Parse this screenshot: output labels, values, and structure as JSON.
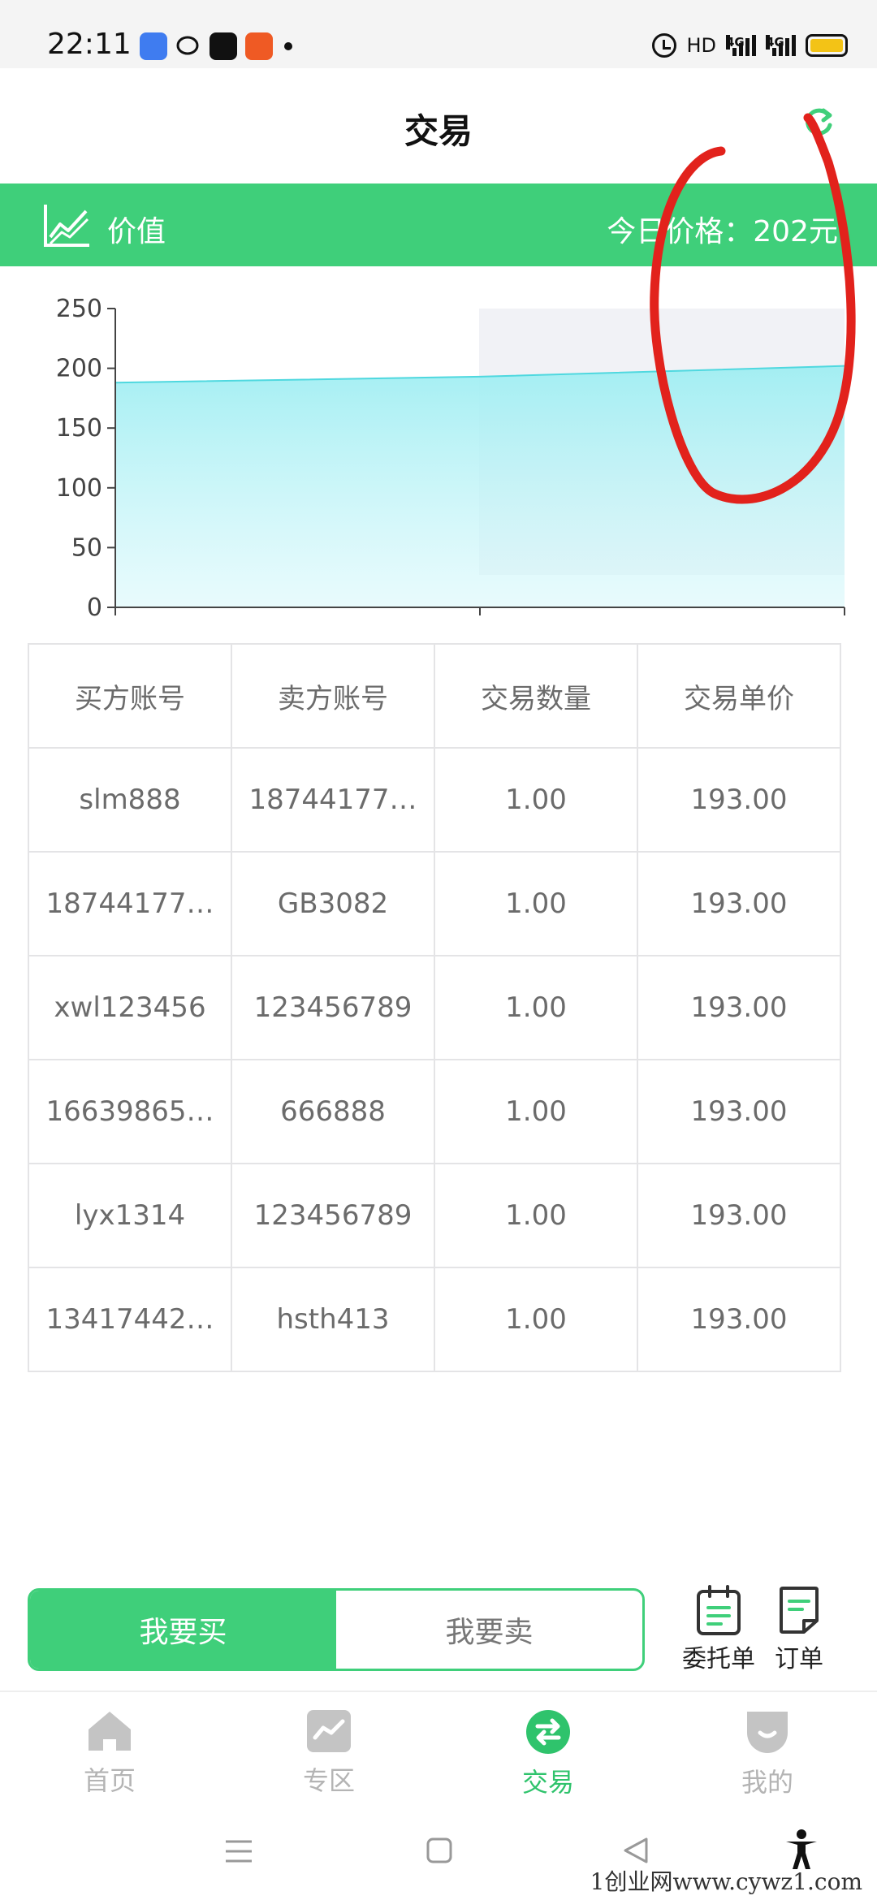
{
  "status_bar": {
    "time": "22:11",
    "network_label": "HD",
    "signal_label_1": "4G",
    "signal_label_2": "4G",
    "notification_icons": [
      "blue-app-icon",
      "chat-bubble-icon",
      "tiktok-icon",
      "orange-app-icon"
    ]
  },
  "header": {
    "title": "交易",
    "refresh_icon": "refresh-icon"
  },
  "value_bar": {
    "label": "价值",
    "price_text": "今日价格：202元",
    "icon": "line-chart-icon"
  },
  "chart_data": {
    "type": "area",
    "x": [
      0,
      1,
      2
    ],
    "values": [
      188,
      193,
      202
    ],
    "yticks": [
      "0",
      "50",
      "100",
      "150",
      "200",
      "250"
    ],
    "ylim": [
      0,
      250
    ],
    "grid": false,
    "title": "",
    "xlabel": "",
    "ylabel": "",
    "colors": {
      "line": "#4fd8df",
      "fill": "#a8eef2"
    }
  },
  "table": {
    "headers": [
      "买方账号",
      "卖方账号",
      "交易数量",
      "交易单价"
    ],
    "rows": [
      [
        "slm888",
        "18744177…",
        "1.00",
        "193.00"
      ],
      [
        "18744177…",
        "GB3082",
        "1.00",
        "193.00"
      ],
      [
        "xwl123456",
        "123456789",
        "1.00",
        "193.00"
      ],
      [
        "16639865…",
        "666888",
        "1.00",
        "193.00"
      ],
      [
        "lyx1314",
        "123456789",
        "1.00",
        "193.00"
      ],
      [
        "13417442…",
        "hsth413",
        "1.00",
        "193.00"
      ]
    ]
  },
  "actions": {
    "buy_label": "我要买",
    "sell_label": "我要卖",
    "entrust_label": "委托单",
    "orders_label": "订单"
  },
  "bottom_nav": [
    {
      "label": "首页",
      "icon": "home-icon",
      "active": false
    },
    {
      "label": "专区",
      "icon": "zone-icon",
      "active": false
    },
    {
      "label": "交易",
      "icon": "exchange-icon",
      "active": true
    },
    {
      "label": "我的",
      "icon": "profile-icon",
      "active": false
    }
  ],
  "watermark": "1创业网www.cywz1.com",
  "colors": {
    "primary": "#3fcf7a",
    "annotation": "#e2221c"
  }
}
